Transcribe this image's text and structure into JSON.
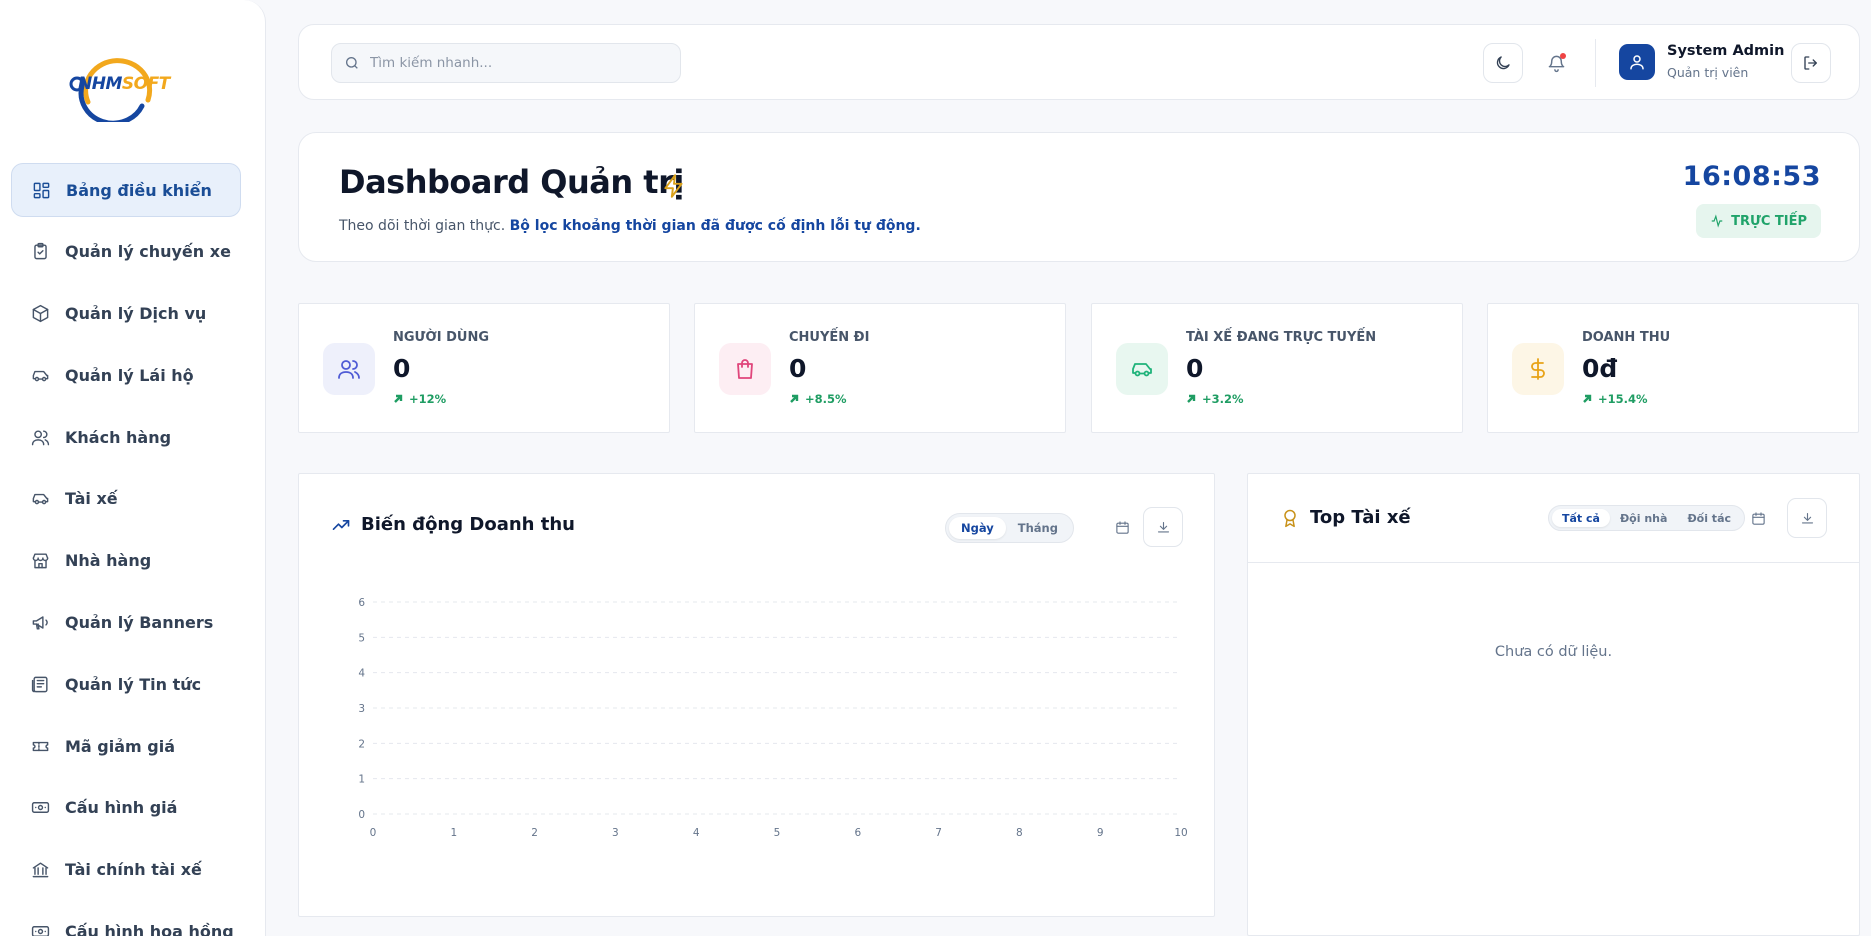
{
  "brand": {
    "logo_primary": "NHM",
    "logo_secondary": "SOFT",
    "primary_color": "#1546a0",
    "accent_color": "#f2a81d"
  },
  "sidebar": {
    "items": [
      {
        "label": "Bảng điều khiển",
        "icon": "dashboard-icon",
        "active": true
      },
      {
        "label": "Quản lý chuyến xe",
        "icon": "clipboard-check-icon"
      },
      {
        "label": "Quản lý Dịch vụ",
        "icon": "package-icon"
      },
      {
        "label": "Quản lý Lái hộ",
        "icon": "car-icon"
      },
      {
        "label": "Khách hàng",
        "icon": "users-icon"
      },
      {
        "label": "Tài xế",
        "icon": "car-icon"
      },
      {
        "label": "Nhà hàng",
        "icon": "store-icon"
      },
      {
        "label": "Quản lý Banners",
        "icon": "megaphone-icon"
      },
      {
        "label": "Quản lý Tin tức",
        "icon": "newspaper-icon"
      },
      {
        "label": "Mã giảm giá",
        "icon": "ticket-icon"
      },
      {
        "label": "Cấu hình giá",
        "icon": "banknote-icon"
      },
      {
        "label": "Tài chính tài xế",
        "icon": "bank-icon"
      },
      {
        "label": "Cấu hình hoa hồng",
        "icon": "banknote-icon"
      }
    ]
  },
  "header": {
    "search_placeholder": "Tìm kiếm nhanh...",
    "user_name": "System Admin",
    "user_role": "Quản trị viên"
  },
  "hero": {
    "title": "Dashboard Quản trị",
    "subtitle": "Theo dõi thời gian thực.",
    "subtitle_highlight": "Bộ lọc khoảng thời gian đã được cố định lỗi tự động.",
    "clock": "16:08:53",
    "live_label": "TRỰC TIẾP"
  },
  "stats": [
    {
      "label": "NGƯỜI DÙNG",
      "value": "0",
      "trend": "+12%",
      "icon": "users-icon",
      "color": "#4f5bd5",
      "bg": "#eef0fb"
    },
    {
      "label": "CHUYẾN ĐI",
      "value": "0",
      "trend": "+8.5%",
      "icon": "shopping-bag-icon",
      "color": "#e0457b",
      "bg": "#fdeef3"
    },
    {
      "label": "TÀI XẾ ĐANG TRỰC TUYẾN",
      "value": "0",
      "trend": "+3.2%",
      "icon": "car-icon",
      "color": "#1fb37a",
      "bg": "#e8f7f0"
    },
    {
      "label": "DOANH THU",
      "value": "0đ",
      "trend": "+15.4%",
      "icon": "dollar-icon",
      "color": "#e8a317",
      "bg": "#fdf6e6"
    }
  ],
  "revenue": {
    "title": "Biến động Doanh thu",
    "range_options": [
      "Ngày",
      "Tháng"
    ],
    "selected": "Ngày"
  },
  "chart_data": {
    "type": "line",
    "x": [
      0,
      1,
      2,
      3,
      4,
      5,
      6,
      7,
      8,
      9,
      10
    ],
    "series": [],
    "xlim": [
      0,
      10
    ],
    "ylim": [
      0,
      6
    ],
    "xticks": [
      0,
      1,
      2,
      3,
      4,
      5,
      6,
      7,
      8,
      9,
      10
    ],
    "yticks": [
      0,
      1,
      2,
      3,
      4,
      5,
      6
    ],
    "grid": true
  },
  "top_drivers": {
    "title": "Top Tài xế",
    "filters": [
      "Tất cả",
      "Đội nhà",
      "Đối tác"
    ],
    "selected": "Tất cả",
    "empty_text": "Chưa có dữ liệu."
  }
}
